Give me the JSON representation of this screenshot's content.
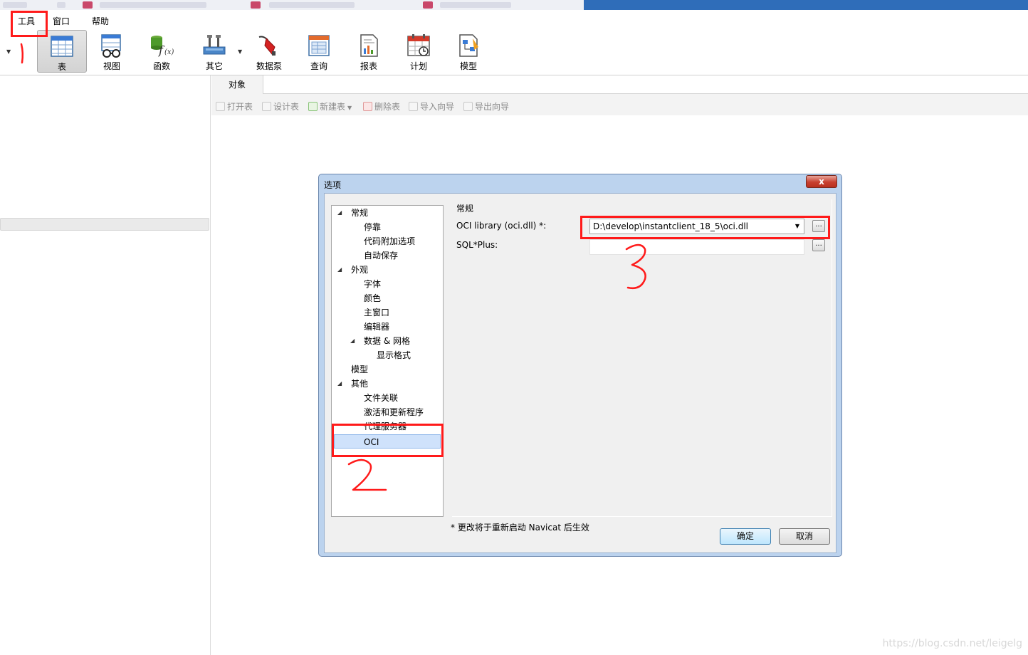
{
  "menubar": {
    "items": [
      "工具",
      "窗口",
      "帮助"
    ]
  },
  "toolbar": {
    "items": [
      {
        "label": "表",
        "icon": "table-icon"
      },
      {
        "label": "视图",
        "icon": "view-icon"
      },
      {
        "label": "函数",
        "icon": "function-icon"
      },
      {
        "label": "其它",
        "icon": "other-icon"
      },
      {
        "label": "数据泵",
        "icon": "data-pump-icon"
      },
      {
        "label": "查询",
        "icon": "query-icon"
      },
      {
        "label": "报表",
        "icon": "report-icon"
      },
      {
        "label": "计划",
        "icon": "schedule-icon"
      },
      {
        "label": "模型",
        "icon": "model-icon"
      }
    ]
  },
  "object_tab": {
    "label": "对象"
  },
  "object_toolbar": {
    "items": [
      "打开表",
      "设计表",
      "新建表",
      "删除表",
      "导入向导",
      "导出向导"
    ]
  },
  "dialog": {
    "title": "选项",
    "close_label": "x",
    "tree": {
      "items": [
        {
          "label": "常规"
        },
        {
          "label": "停靠"
        },
        {
          "label": "代码附加选项"
        },
        {
          "label": "自动保存"
        },
        {
          "label": "外观"
        },
        {
          "label": "字体"
        },
        {
          "label": "颜色"
        },
        {
          "label": "主窗口"
        },
        {
          "label": "编辑器"
        },
        {
          "label": "数据 & 网格"
        },
        {
          "label": "显示格式"
        },
        {
          "label": "模型"
        },
        {
          "label": "其他"
        },
        {
          "label": "文件关联"
        },
        {
          "label": "激活和更新程序"
        },
        {
          "label": "代理服务器"
        },
        {
          "label": "OCI"
        }
      ],
      "selected": "OCI"
    },
    "section_title": "常规",
    "oci_library": {
      "label": "OCI library (oci.dll) *:",
      "value": "D:\\develop\\instantclient_18_5\\oci.dll"
    },
    "sqlplus": {
      "label": "SQL*Plus:",
      "value": ""
    },
    "browse_label": "...",
    "note": "* 更改将于重新启动 Navicat 后生效",
    "ok_label": "确定",
    "cancel_label": "取消"
  },
  "annotations": {
    "numbers": [
      "1",
      "2",
      "3"
    ],
    "color": "#ff1a1a"
  },
  "watermark": "https://blog.csdn.net/leigelg",
  "colors": {
    "dialog_frame": "#bcd3ee",
    "selected_item": "#cfe2fb",
    "default_button": "#bee6fd"
  }
}
